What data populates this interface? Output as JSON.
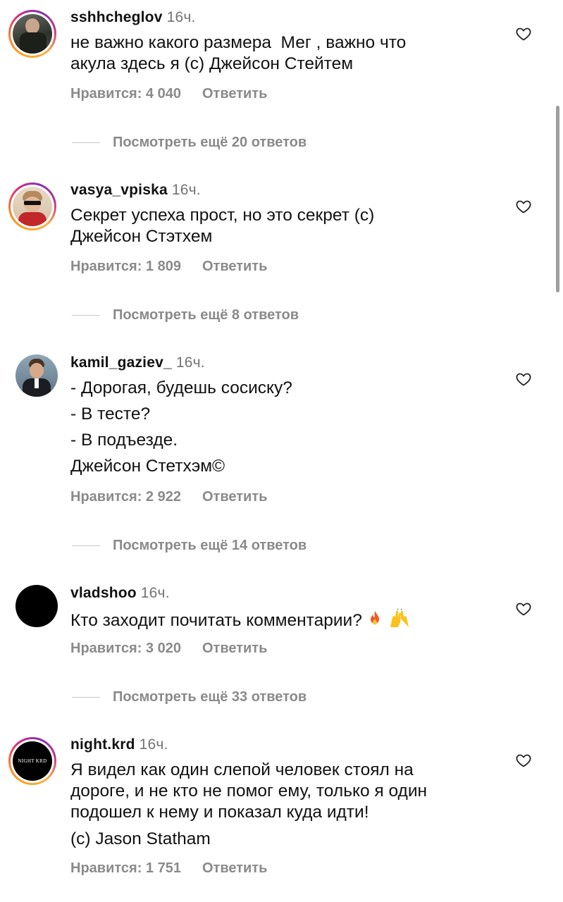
{
  "comments": [
    {
      "username": "sshhcheglov",
      "time": "16ч.",
      "lines": [
        "не важно какого размера  Мег , важно что",
        "акула здесь я (с) Джейсон Стейтем"
      ],
      "likes": "Нравится: 4 040",
      "reply": "Ответить",
      "view_replies": "Посмотреть ещё 20 ответов",
      "avatar_icon": "photo-avatar"
    },
    {
      "username": "vasya_vpiska",
      "time": "16ч.",
      "lines": [
        "Секрет успеха прост, но это секрет (с)",
        "Джейсон Стэтхем"
      ],
      "likes": "Нравится: 1 809",
      "reply": "Ответить",
      "view_replies": "Посмотреть ещё 8 ответов",
      "avatar_icon": "photo-avatar"
    },
    {
      "username": "kamil_gaziev_",
      "time": "16ч.",
      "lines": [
        "- Дорогая, будешь сосиску?",
        "- В тесте?",
        "- В подъезде.",
        "Джейсон Стетхэм©"
      ],
      "likes": "Нравится: 2 922",
      "reply": "Ответить",
      "view_replies": "Посмотреть ещё 14 ответов",
      "avatar_icon": "photo-avatar"
    },
    {
      "username": "vladshoo",
      "time": "16ч.",
      "lines": [
        "Кто заходит почитать комментарии?"
      ],
      "emojis": [
        "fire-emoji",
        "raised-hands-emoji"
      ],
      "likes": "Нравится: 3 020",
      "reply": "Ответить",
      "view_replies": "Посмотреть ещё 33 ответов",
      "avatar_icon": "black-circle-avatar"
    },
    {
      "username": "night.krd",
      "time": "16ч.",
      "lines": [
        "Я видел как один слепой человек стоял на",
        "дороге, и не кто не помог ему, только я один",
        "подошел к нему и показал куда идти!"
      ],
      "signature": "(c) Jason Statham",
      "likes": "Нравится: 1 751",
      "reply": "Ответить",
      "avatar_text": "NIGHT KRD",
      "avatar_icon": "logo-avatar"
    }
  ],
  "colors": {
    "muted": "#8a8a8a",
    "time": "#737373",
    "story_ring": [
      "#f5a623",
      "#dd2a7b",
      "#8134af"
    ]
  }
}
